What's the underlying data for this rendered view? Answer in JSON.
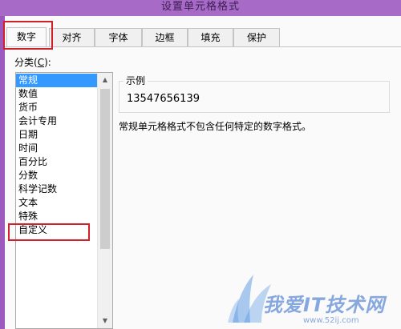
{
  "window": {
    "title": "设置单元格格式"
  },
  "tabs": [
    {
      "label": "数字",
      "active": true
    },
    {
      "label": "对齐",
      "active": false
    },
    {
      "label": "字体",
      "active": false
    },
    {
      "label": "边框",
      "active": false
    },
    {
      "label": "填充",
      "active": false
    },
    {
      "label": "保护",
      "active": false
    }
  ],
  "category": {
    "label_prefix": "分类(",
    "label_hotkey": "C",
    "label_suffix": "):",
    "items": [
      "常规",
      "数值",
      "货币",
      "会计专用",
      "日期",
      "时间",
      "百分比",
      "分数",
      "科学记数",
      "文本",
      "特殊",
      "自定义"
    ],
    "selected": "常规"
  },
  "sample": {
    "legend": "示例",
    "value": "13547656139"
  },
  "description": "常规单元格格式不包含任何特定的数字格式。",
  "watermark": {
    "text": "我爱IT技术网",
    "url": "www.52ij.com"
  },
  "colors": {
    "highlight": "#d21f2a",
    "selection": "#3399ff",
    "titlebar": "#a76ac7"
  }
}
